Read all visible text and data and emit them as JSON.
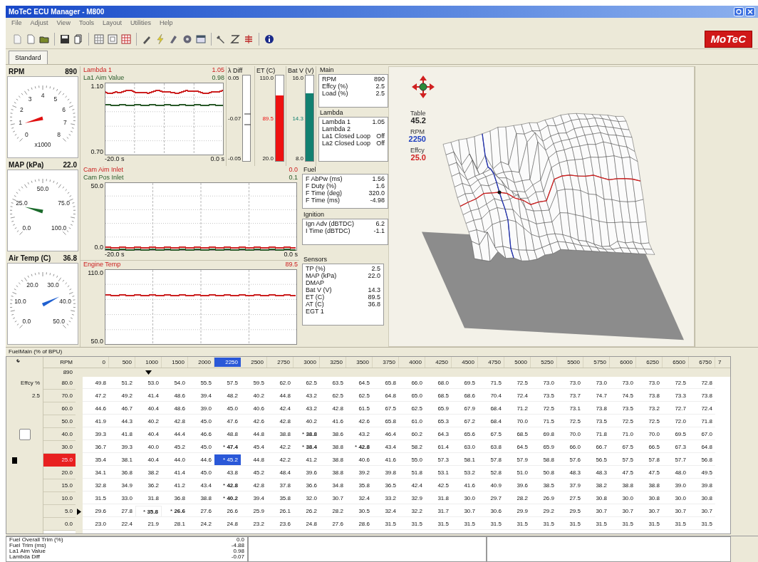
{
  "window": {
    "title": "MoTeC ECU Manager - M800"
  },
  "menu": [
    "File",
    "Adjust",
    "View",
    "Tools",
    "Layout",
    "Utilities",
    "Help"
  ],
  "logo": "MoTeC",
  "tabs": [
    {
      "label": "Standard",
      "selected": true
    }
  ],
  "gauges": [
    {
      "title": "RPM",
      "value": "890",
      "color": "#e01010",
      "scale_labels": [
        "0",
        "1",
        "2",
        "3",
        "4",
        "5",
        "6",
        "7",
        "8"
      ],
      "unit_label": "x1000"
    },
    {
      "title": "MAP (kPa)",
      "value": "22.0",
      "color": "#1a6a2a",
      "scale_labels": [
        "0.0",
        "25.0",
        "50.0",
        "75.0",
        "100.0"
      ]
    },
    {
      "title": "Air Temp (C)",
      "value": "36.8",
      "color": "#2060d0",
      "scale_labels": [
        "0.0",
        "10.0",
        "20.0",
        "30.0",
        "40.0",
        "50.0"
      ]
    }
  ],
  "trend_charts": [
    {
      "series": [
        {
          "name": "Lambda 1",
          "reading": "1.05",
          "color": "#cc2020",
          "kind": "wavy"
        },
        {
          "name": "La1 Aim Value",
          "reading": "0.98",
          "color": "#2a5a2a",
          "kind": "flat"
        }
      ],
      "y_labels": [
        "1.10",
        "0.70"
      ],
      "x_labels": [
        "-20.0 s",
        "0.0 s"
      ]
    },
    {
      "series": [
        {
          "name": "Cam Aim Inlet",
          "reading": "0.0",
          "color": "#cc2020",
          "kind": "flat"
        },
        {
          "name": "Cam Pos Inlet",
          "reading": "0.1",
          "color": "#2a5a2a",
          "kind": "flat"
        }
      ],
      "y_labels": [
        "50.0",
        "0.0"
      ],
      "x_labels": [
        "-20.0 s",
        "0.0 s"
      ]
    },
    {
      "series": [
        {
          "name": "Engine Temp",
          "reading": "89.5",
          "color": "#cc2020",
          "kind": "flat"
        }
      ],
      "y_labels": [
        "110.0",
        "50.0"
      ]
    }
  ],
  "diff_bar": {
    "title": "λ Diff",
    "labels": [
      "0.05",
      "-0.07",
      "-0.05"
    ]
  },
  "bar_gauges": [
    {
      "title": "ET (C)",
      "labels": [
        "110.0",
        "89.5",
        "20.0"
      ],
      "level": 0.77,
      "color": "#ee1111"
    },
    {
      "title": "Bat V (V)",
      "labels": [
        "16.0",
        "14.3",
        "8.0"
      ],
      "level": 0.79,
      "color": "#128070"
    }
  ],
  "panels": [
    {
      "title": "Main",
      "rows": [
        {
          "label": "RPM",
          "value": "890"
        },
        {
          "label": "Effcy (%)",
          "value": "2.5"
        },
        {
          "label": "Load (%)",
          "value": "2.5"
        }
      ]
    },
    {
      "title": "Lambda",
      "rows": [
        {
          "label": "Lambda 1",
          "value": "1.05"
        },
        {
          "label": "Lambda 2"
        },
        {
          "label": "La1 Closed Loop",
          "value": "Off"
        },
        {
          "label": "La2 Closed Loop",
          "value": "Off"
        }
      ]
    },
    {
      "title": "Fuel",
      "rows": [
        {
          "label": "F AbPw (ms)",
          "value": "1.56"
        },
        {
          "label": "F Duty (%)",
          "value": "1.6"
        },
        {
          "label": "F Time (deg)",
          "value": "320.0"
        },
        {
          "label": "F Time (ms)",
          "value": "-4.98"
        }
      ]
    },
    {
      "title": "Ignition",
      "rows": [
        {
          "label": "Ign Adv (dBTDC)",
          "value": "6.2"
        },
        {
          "label": "I Time (dBTDC)",
          "value": "-1.1"
        }
      ]
    },
    {
      "title": "Sensors",
      "rows": [
        {
          "label": "TP (%)",
          "value": "2.5"
        },
        {
          "label": "MAP (kPa)",
          "value": "22.0"
        },
        {
          "label": "DMAP"
        },
        {
          "label": "Bat V (V)",
          "value": "14.3"
        },
        {
          "label": "ET (C)",
          "value": "89.5"
        },
        {
          "label": "AT (C)",
          "value": "36.8"
        },
        {
          "label": "EGT 1"
        }
      ]
    }
  ],
  "map_view": {
    "readouts": [
      {
        "label": "Table",
        "value": "45.2",
        "color": "#222222"
      },
      {
        "label": "RPM",
        "value": "2250",
        "color": "#2040c0"
      },
      {
        "label": "Effcy",
        "value": "25.0",
        "color": "#d02020"
      }
    ]
  },
  "table": {
    "title": "FuelMain (% of BPU)",
    "axis_label": "RPM",
    "axis_value": "890",
    "load_label": "Effcy %",
    "load_value": "2.5",
    "columns": [
      {
        "label": "0",
        "selected": false,
        "marked": false
      },
      {
        "label": "500",
        "selected": false,
        "marked": false
      },
      {
        "label": "1000",
        "selected": false,
        "marked": true
      },
      {
        "label": "1500",
        "selected": false,
        "marked": false
      },
      {
        "label": "2000",
        "selected": false,
        "marked": false
      },
      {
        "label": "2250",
        "selected": true,
        "marked": false
      },
      {
        "label": "2500",
        "selected": false,
        "marked": false
      },
      {
        "label": "2750",
        "selected": false,
        "marked": false
      },
      {
        "label": "3000",
        "selected": false,
        "marked": false
      },
      {
        "label": "3250",
        "selected": false,
        "marked": false
      },
      {
        "label": "3500",
        "selected": false,
        "marked": false
      },
      {
        "label": "3750",
        "selected": false,
        "marked": false
      },
      {
        "label": "4000",
        "selected": false,
        "marked": false
      },
      {
        "label": "4250",
        "selected": false,
        "marked": false
      },
      {
        "label": "4500",
        "selected": false,
        "marked": false
      },
      {
        "label": "4750",
        "selected": false,
        "marked": false
      },
      {
        "label": "5000",
        "selected": false,
        "marked": false
      },
      {
        "label": "5250",
        "selected": false,
        "marked": false
      },
      {
        "label": "5500",
        "selected": false,
        "marked": false
      },
      {
        "label": "5750",
        "selected": false,
        "marked": false
      },
      {
        "label": "6000",
        "selected": false,
        "marked": false
      },
      {
        "label": "6250",
        "selected": false,
        "marked": false
      },
      {
        "label": "6500",
        "selected": false,
        "marked": false
      },
      {
        "label": "6750",
        "selected": false,
        "marked": false
      }
    ],
    "cut_column_label": "7",
    "rows": [
      {
        "label": "80.0",
        "selected": false,
        "marked": false,
        "cells": [
          "49.8",
          "51.2",
          "53.0",
          "54.0",
          "55.5",
          "57.5",
          "59.5",
          "62.0",
          "62.5",
          "63.5",
          "64.5",
          "65.8",
          "66.0",
          "68.0",
          "69.5",
          "71.5",
          "72.5",
          "73.0",
          "73.0",
          "73.0",
          "73.0",
          "73.0",
          "72.5",
          "72.8"
        ]
      },
      {
        "label": "70.0",
        "selected": false,
        "marked": false,
        "cells": [
          "47.2",
          "49.2",
          "41.4",
          "48.6",
          "39.4",
          "48.2",
          "40.2",
          "44.8",
          "43.2",
          "62.5",
          "62.5",
          "64.8",
          "65.0",
          "68.5",
          "68.6",
          "70.4",
          "72.4",
          "73.5",
          "73.7",
          "74.7",
          "74.5",
          "73.8",
          "73.3",
          "73.8"
        ]
      },
      {
        "label": "60.0",
        "selected": false,
        "marked": false,
        "cells": [
          "44.6",
          "46.7",
          "40.4",
          "48.6",
          "39.0",
          "45.0",
          "40.6",
          "42.4",
          "43.2",
          "42.8",
          "61.5",
          "67.5",
          "62.5",
          "65.9",
          "67.9",
          "68.4",
          "71.2",
          "72.5",
          "73.1",
          "73.8",
          "73.5",
          "73.2",
          "72.7",
          "72.4"
        ]
      },
      {
        "label": "50.0",
        "selected": false,
        "marked": false,
        "cells": [
          "41.9",
          "44.3",
          "40.2",
          "42.8",
          "45.0",
          "47.6",
          "42.6",
          "42.8",
          "40.2",
          "41.6",
          "42.6",
          "65.8",
          "61.0",
          "65.3",
          "67.2",
          "68.4",
          "70.0",
          "71.5",
          "72.5",
          "73.5",
          "72.5",
          "72.5",
          "72.0",
          "71.8"
        ]
      },
      {
        "label": "40.0",
        "selected": false,
        "marked": false,
        "cells": [
          "39.3",
          "41.8",
          "40.4",
          "44.4",
          "46.6",
          "48.8",
          "44.8",
          "38.8",
          {
            "flag": "*",
            "text": "38.8",
            "bold": true,
            "selected": false,
            "outlined": false
          },
          "38.6",
          "43.2",
          "46.4",
          "60.2",
          "64.3",
          "65.6",
          "67.5",
          "68.5",
          "69.8",
          "70.0",
          "71.8",
          "71.0",
          "70.0",
          "69.5",
          "67.0"
        ]
      },
      {
        "label": "30.0",
        "selected": false,
        "marked": false,
        "cells": [
          "36.7",
          "39.3",
          "40.0",
          "45.2",
          "45.0",
          {
            "flag": "*",
            "text": "47.4",
            "bold": true,
            "selected": false,
            "outlined": false
          },
          "45.4",
          "42.2",
          {
            "flag": "*",
            "text": "38.4",
            "bold": true,
            "selected": false,
            "outlined": false
          },
          "38.8",
          {
            "flag": "*",
            "text": "42.8",
            "bold": true,
            "selected": false,
            "outlined": false
          },
          "43.4",
          "58.2",
          "61.4",
          "63.0",
          "63.8",
          "64.5",
          "65.9",
          "66.0",
          "66.7",
          "67.5",
          "66.5",
          "67.3",
          "64.8"
        ]
      },
      {
        "label": "25.0",
        "selected": true,
        "marked": false,
        "cells": [
          "35.4",
          "38.1",
          "40.4",
          "44.0",
          "44.6",
          {
            "flag": "*",
            "text": "45.2",
            "bold": false,
            "selected": true,
            "outlined": false
          },
          "44.8",
          "42.2",
          "41.2",
          "38.8",
          "40.6",
          "41.6",
          "55.0",
          "57.3",
          "58.1",
          "57.8",
          "57.9",
          "58.8",
          "57.6",
          "56.5",
          "57.5",
          "57.8",
          "57.7",
          "56.8"
        ]
      },
      {
        "label": "20.0",
        "selected": false,
        "marked": false,
        "cells": [
          "34.1",
          "36.8",
          "38.2",
          "41.4",
          "45.0",
          "43.8",
          "45.2",
          "48.4",
          "39.6",
          "38.8",
          "39.2",
          "39.8",
          "51.8",
          "53.1",
          "53.2",
          "52.8",
          "51.0",
          "50.8",
          "48.3",
          "48.3",
          "47.5",
          "47.5",
          "48.0",
          "49.5"
        ]
      },
      {
        "label": "15.0",
        "selected": false,
        "marked": false,
        "cells": [
          "32.8",
          "34.9",
          "36.2",
          "41.2",
          "43.4",
          {
            "flag": "*",
            "text": "42.8",
            "bold": true,
            "selected": false,
            "outlined": false
          },
          "42.8",
          "37.8",
          "36.6",
          "34.8",
          "35.8",
          "36.5",
          "42.4",
          "42.5",
          "41.6",
          "40.9",
          "39.6",
          "38.5",
          "37.9",
          "38.2",
          "38.8",
          "38.8",
          "39.0",
          "39.8"
        ]
      },
      {
        "label": "10.0",
        "selected": false,
        "marked": false,
        "cells": [
          "31.5",
          "33.0",
          "31.8",
          "36.8",
          "38.8",
          {
            "flag": "*",
            "text": "40.2",
            "bold": true,
            "selected": false,
            "outlined": false
          },
          "39.4",
          "35.8",
          "32.0",
          "30.7",
          "32.4",
          "33.2",
          "32.9",
          "31.8",
          "30.0",
          "29.7",
          "28.2",
          "26.9",
          "27.5",
          "30.8",
          "30.0",
          "30.8",
          "30.0",
          "30.8"
        ]
      },
      {
        "label": "5.0",
        "selected": false,
        "marked": true,
        "cells": [
          "29.6",
          "27.8",
          {
            "flag": "*",
            "text": "35.8",
            "bold": true,
            "selected": false,
            "outlined": true
          },
          {
            "flag": "*",
            "text": "26.6",
            "bold": true,
            "selected": false,
            "outlined": false
          },
          "27.6",
          "26.6",
          "25.9",
          "26.1",
          "26.2",
          "28.2",
          "30.5",
          "32.4",
          "32.2",
          "31.7",
          "30.7",
          "30.6",
          "29.9",
          "29.2",
          "29.5",
          "30.7",
          "30.7",
          "30.7",
          "30.7",
          "30.7"
        ]
      },
      {
        "label": "0.0",
        "selected": false,
        "marked": false,
        "cells": [
          "23.0",
          "22.4",
          "21.9",
          "28.1",
          "24.2",
          "24.8",
          "23.2",
          "23.6",
          "24.8",
          "27.6",
          "28.6",
          "31.5",
          "31.5",
          "31.5",
          "31.5",
          "31.5",
          "31.5",
          "31.5",
          "31.5",
          "31.5",
          "31.5",
          "31.5",
          "31.5",
          "31.5"
        ]
      }
    ]
  },
  "bottom_panel": {
    "rows": [
      {
        "label": "Fuel Overall Trim (%)",
        "value": "0.0"
      },
      {
        "label": "Fuel Trim (ms)",
        "value": "-4.88"
      },
      {
        "label": "La1 Aim Value",
        "value": "0.98"
      },
      {
        "label": "Lambda Diff",
        "value": "-0.07"
      }
    ]
  }
}
